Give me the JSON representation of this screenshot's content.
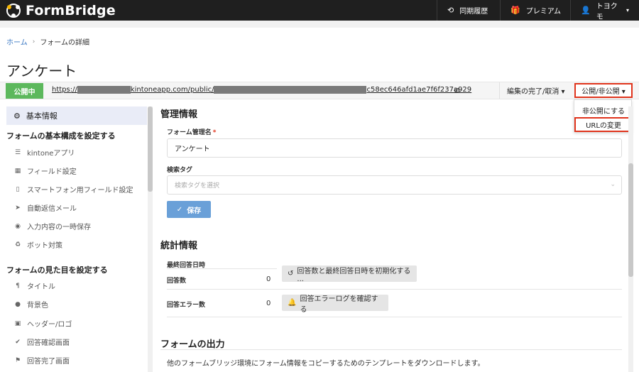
{
  "app": {
    "name": "FormBridge"
  },
  "topnav": {
    "sync_history": "同期履歴",
    "premium": "プレミアム",
    "user": "トヨクモ"
  },
  "breadcrumb": {
    "home": "ホーム",
    "current": "フォームの詳細"
  },
  "page": {
    "title": "アンケート"
  },
  "urlbar": {
    "status": "公開中",
    "url_prefix": "https://",
    "url_mid": "kintoneapp.com/public/",
    "url_suffix": "c58ec646afd1ae7f6f237a929",
    "edit_menu": "編集の完了/取消 ▾",
    "publish_menu": "公開/非公開 ▾"
  },
  "dropdown": {
    "items": [
      "非公開にする",
      "URLの変更"
    ]
  },
  "sidebar": {
    "active": "基本情報",
    "group1": "フォームの基本構成を設定する",
    "group1_items": [
      "kintoneアプリ",
      "フィールド設定",
      "スマートフォン用フィールド設定",
      "自動返信メール",
      "入力内容の一時保存",
      "ボット対策"
    ],
    "group2": "フォームの見た目を設定する",
    "group2_items": [
      "タイトル",
      "背景色",
      "ヘッダー/ロゴ",
      "回答確認画面",
      "回答完了画面"
    ]
  },
  "management": {
    "title": "管理情報",
    "name_label": "フォーム管理名",
    "name_value": "アンケート",
    "tag_label": "検索タグ",
    "tag_placeholder": "検索タグを選択",
    "save_label": "保存"
  },
  "stats": {
    "title": "統計情報",
    "last_answer_label": "最終回答日時",
    "count_label": "回答数",
    "count_value": "0",
    "reset_label": "回答数と最終回答日時を初期化する ...",
    "error_label": "回答エラー数",
    "error_value": "0",
    "error_log_label": "回答エラーログを確認する"
  },
  "output": {
    "title": "フォームの出力",
    "description": "他のフォームブリッジ環境にフォーム情報をコピーするためのテンプレートをダウンロードします。"
  },
  "colors": {
    "accent": "#5cb85c",
    "highlight": "#e0341c",
    "primary": "#6aa0d8"
  }
}
